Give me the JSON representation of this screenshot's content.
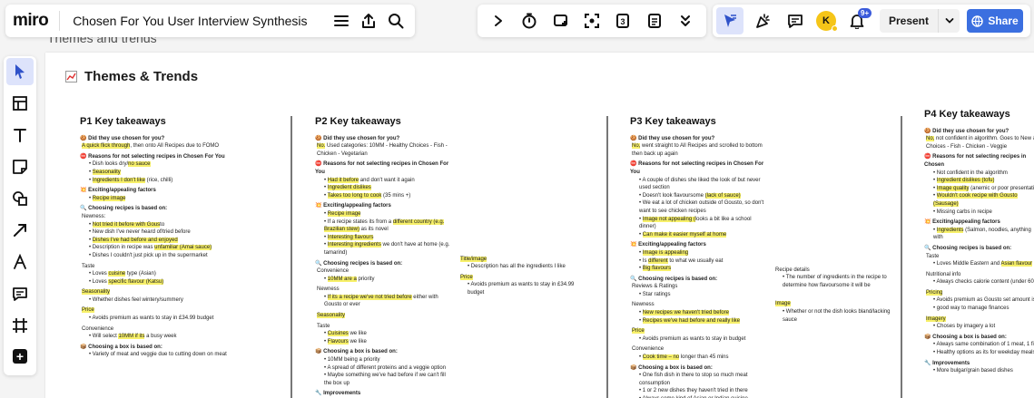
{
  "app": {
    "logo": "miro",
    "board_name": "Chosen For You User Interview Synthesis"
  },
  "topbar": {
    "avatar_initial": "K",
    "notifications_badge": "9+",
    "present_label": "Present",
    "share_label": "Share"
  },
  "board": {
    "frame_label": "Themes and trends",
    "title": "Themes & Trends",
    "columns": [
      {
        "heading": "P1 Key takeaways",
        "sections": [
          {
            "q": "🍪 Did they use chosen for you?",
            "lines": [
              "A quick flick through, then onto All Recipes due to FOMO"
            ]
          },
          {
            "q": "⛔ Reasons for not selecting recipes in Chosen For You",
            "items": [
              "Dish looks dry/no sauce",
              "Seasonality",
              "Ingredients I don't like (rice, chilli)"
            ]
          },
          {
            "q": "💥 Exciting/appealing factors",
            "items": [
              "Recipe image"
            ]
          },
          {
            "q": "🔍 Choosing recipes is based on:",
            "lines": [
              "Newness:"
            ],
            "items": [
              "Not tried it before with Gousto",
              "New dish I've never heard of/tried before",
              "Dishes I've had before and enjoyed",
              "Description in recipe was unfamiliar (Amai sauce)",
              "Dishes I couldn't just pick up in the supermarket"
            ]
          },
          {
            "lines": [
              "Taste"
            ],
            "items": [
              "Loves cuisine type (Asian)",
              "Loves specific flavour (Katsu)"
            ]
          },
          {
            "lines": [
              "Seasonality"
            ],
            "items": [
              "Whether dishes feel wintery/summery"
            ]
          },
          {
            "lines": [
              "Price"
            ],
            "items": [
              "Avoids premium as wants to stay in £34.99 budget"
            ]
          },
          {
            "lines": [
              "Convenience"
            ],
            "items": [
              "Will select 10MM if its a busy week"
            ]
          },
          {
            "q": "📦 Choosing a box is based on:",
            "items": [
              "Variety of meat and veggie due to cutting down on meat"
            ]
          }
        ]
      },
      {
        "heading": "P2 Key takeaways",
        "sections": [
          {
            "q": "🍪 Did they use chosen for you?",
            "lines": [
              "No. Used categories: 10MM - Healthy Choices - Fish - Chicken - Vegetarian"
            ]
          },
          {
            "q": "⛔ Reasons for not selecting recipes in Chosen For You",
            "items": [
              "Had it before and don't want it again",
              "Ingredient dislikes",
              "Takes too long to cook (35 mins +)"
            ]
          },
          {
            "q": "💥 Exciting/appealing factors",
            "items": [
              "Recipe image",
              "If a recipe states its from a different country (e.g. Brazilian stew) as its novel",
              "Interesting flavours",
              "Interesting ingredients we don't have at home (e.g. tamarind)"
            ]
          },
          {
            "q": "🔍 Choosing recipes is based on:",
            "lines": [
              "Convenience"
            ],
            "items": [
              "10MM are a priority"
            ]
          },
          {
            "lines": [
              "Newness"
            ],
            "items": [
              "If its a recipe we've not tried before either with Gousto or ever"
            ]
          },
          {
            "lines": [
              "Seasonality"
            ]
          },
          {
            "lines": [
              "Taste"
            ],
            "items": [
              "Cuisines we like",
              "Flavours we like"
            ]
          },
          {
            "q": "📦 Choosing a box is based on:",
            "items": [
              "10MM being a priority",
              "A spread of different proteins and a veggie option",
              "Maybe something we've had before if we can't fill the box up"
            ]
          },
          {
            "q": "🔧 Improvements"
          }
        ],
        "side_notes": [
          {
            "label": "Title/image",
            "items": [
              "Description has all the ingredients I like"
            ]
          },
          {
            "label": "Price",
            "items": [
              "Avoids premium as wants to stay in £34.99 budget"
            ]
          }
        ]
      },
      {
        "heading": "P3 Key takeaways",
        "sections": [
          {
            "q": "🍪 Did they use chosen for you?",
            "lines": [
              "No, went straight to All Recipes and scrolled to bottom then back up again"
            ]
          },
          {
            "q": "⛔ Reasons for not selecting recipes in Chosen For You",
            "items": [
              "A couple of dishes she liked the look of but never used section",
              "Doesn't look flavoursome (lack of sauce)",
              "We eat a lot of chicken outside of Gousto, so don't want to see chicken recipes",
              "Image not appealing (looks a bit like a school dinner)",
              "Can make it easier myself at home"
            ]
          },
          {
            "q": "💥 Exciting/appealing factors",
            "items": [
              "Image is appealing",
              "Is different to what we usually eat",
              "Big flavours"
            ]
          },
          {
            "q": "🔍 Choosing recipes is based on:",
            "lines": [
              "Reviews & Ratings"
            ],
            "items": [
              "Star ratings"
            ]
          },
          {
            "lines": [
              "Newness"
            ],
            "items": [
              "New recipes we haven't tried before",
              "Recipes we've had before and really like"
            ]
          },
          {
            "lines": [
              "Price"
            ],
            "items": [
              "Avoids premium as wants to stay in budget"
            ]
          },
          {
            "lines": [
              "Convenience"
            ],
            "items": [
              "Cook time – no longer than 45 mins"
            ]
          },
          {
            "q": "📦 Choosing a box is based on:",
            "items": [
              "One fish dish in there to stop so much meat consumption",
              "1 or 2 new dishes they haven't tried in there",
              "Always some kind of Asian or Indian cuisine"
            ]
          }
        ],
        "side_notes": [
          {
            "label": "Recipe details",
            "items": [
              "The number of ingredients in the recipe to determine how flavoursome it will be"
            ]
          },
          {
            "label": "Image",
            "items": [
              "Whether or not the dish looks bland/lacking sauce"
            ]
          }
        ]
      },
      {
        "heading": "P4 Key takeaways",
        "sections": [
          {
            "q": "🍪 Did they use chosen for you?",
            "lines": [
              "No, not confident in algorithm. Goes to New &",
              "Choices - Fish - Chicken - Veggie"
            ]
          },
          {
            "q": "⛔ Reasons for not selecting recipes in Chosen",
            "items": [
              "Not confident in the algorithm",
              "Ingredient dislikes (tofu)",
              "Image quality (anemic or poor presentation)",
              "Wouldn't cook recipe with Gousto (Sausage)",
              "Missing carbs in recipe"
            ]
          },
          {
            "q": "💥 Exciting/appealing factors",
            "items": [
              "Ingredients (Salmon, noodles, anything with"
            ]
          },
          {
            "q": "🔍 Choosing recipes is based on:",
            "lines": [
              "Taste"
            ],
            "items": [
              "Loves Middle Eastern and Asian flavour"
            ]
          },
          {
            "lines": [
              "Nutritional info"
            ],
            "items": [
              "Always checks calorie content (under 600k"
            ]
          },
          {
            "lines": [
              "Pricing"
            ],
            "items": [
              "Avoids premium as Gousto set amount is",
              "good way to manage finances"
            ]
          },
          {
            "lines": [
              "Imagery"
            ],
            "items": [
              "Choses by imagery a lot"
            ]
          },
          {
            "q": "📦 Choosing a box is based on:",
            "items": [
              "Always same combination of 1 meat, 1 fish",
              "Healthy options as its for weekday meals"
            ]
          },
          {
            "q": "🔧 Improvements",
            "items": [
              "More bulgar/grain based dishes"
            ]
          }
        ]
      }
    ]
  }
}
